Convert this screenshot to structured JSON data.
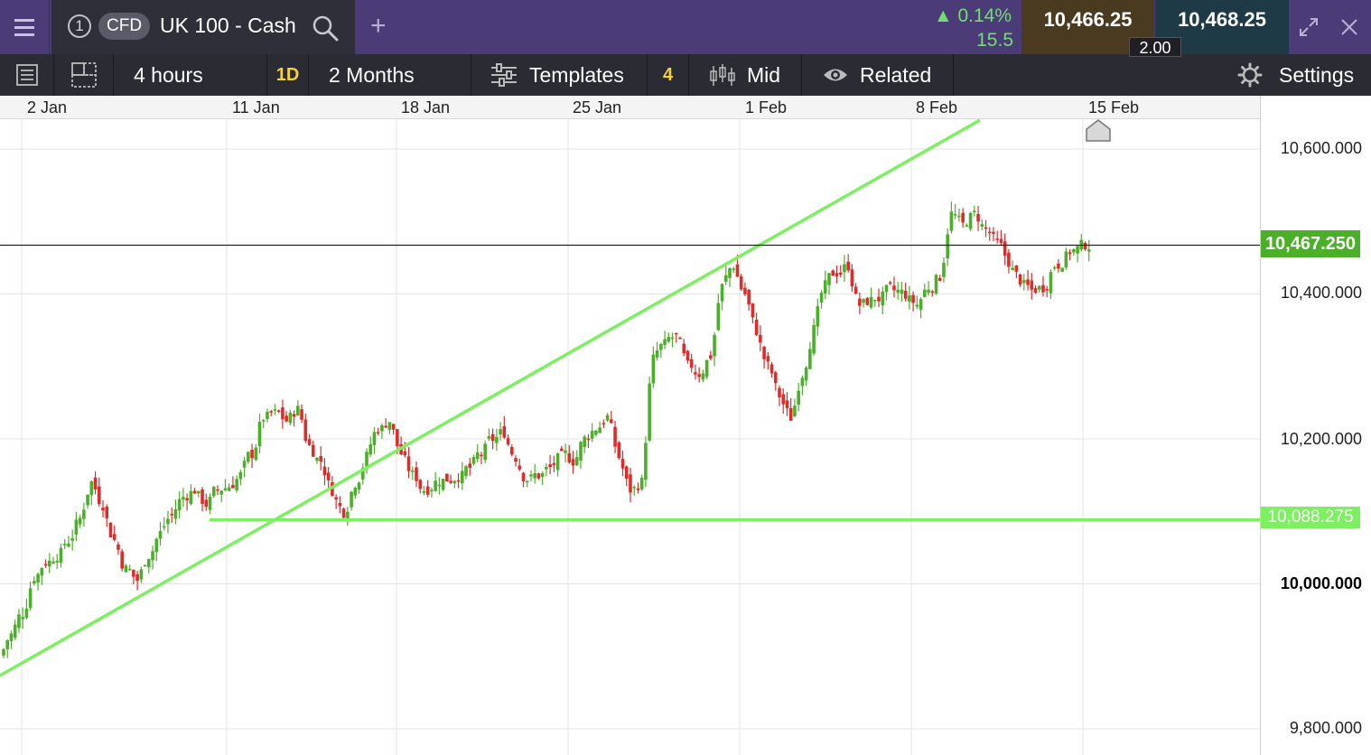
{
  "header": {
    "tab_number": "1",
    "instrument_type": "CFD",
    "instrument_name": "UK 100 - Cash",
    "change_pct": "▲ 0.14%",
    "change_abs": "15.5",
    "sell_price": "10,466.25",
    "buy_price": "10,468.25",
    "spread": "2.00",
    "icons": [
      "menu-icon",
      "search-icon",
      "add-icon",
      "expand-icon",
      "close-icon"
    ]
  },
  "toolbar": {
    "interval": "4 hours",
    "chart_type_badge": "1D",
    "period": "2 Months",
    "templates_label": "Templates",
    "indicator_count": "4",
    "price_mode": "Mid",
    "related_label": "Related",
    "settings_label": "Settings"
  },
  "date_axis": [
    "2 Jan",
    "11 Jan",
    "18 Jan",
    "25 Jan",
    "1 Feb",
    "8 Feb",
    "15 Feb"
  ],
  "price_axis": {
    "ticks": [
      "10,600.000",
      "10,400.000",
      "10,200.000",
      "10,000.000",
      "9,800.000"
    ],
    "current_price_tag": "10,467.250",
    "line_price_tag": "10,088.275"
  },
  "colors": {
    "header_bg": "#4b3b76",
    "up_candle": "#4caf2a",
    "down_candle": "#e02b2b",
    "drawing_line": "#7cf060",
    "current_price_tag": "#4caf2a"
  },
  "chart_data": {
    "type": "candlestick",
    "ylim": [
      9800,
      10600
    ],
    "drawings": [
      {
        "kind": "trendline",
        "from": [
          "2 Jan",
          9935
        ],
        "to": [
          "10 Feb",
          10615
        ]
      },
      {
        "kind": "horizontal",
        "price": 10088.275,
        "from": "10 Jan"
      }
    ],
    "current_price": 10467.25,
    "closes": [
      9930,
      9960,
      10010,
      10030,
      10040,
      10060,
      10090,
      10140,
      10110,
      10060,
      10020,
      10005,
      10040,
      10070,
      10095,
      10120,
      10130,
      10110,
      10130,
      10135,
      10150,
      10180,
      10230,
      10235,
      10225,
      10240,
      10190,
      10170,
      10130,
      10100,
      10140,
      10175,
      10215,
      10225,
      10180,
      10150,
      10130,
      10140,
      10145,
      10150,
      10160,
      10180,
      10200,
      10210,
      10175,
      10145,
      10150,
      10160,
      10175,
      10170,
      10200,
      10215,
      10230,
      10175,
      10130,
      10140,
      10310,
      10330,
      10340,
      10300,
      10290,
      10315,
      10410,
      10440,
      10400,
      10350,
      10300,
      10260,
      10230,
      10290,
      10350,
      10410,
      10430,
      10440,
      10385,
      10390,
      10395,
      10405,
      10400,
      10385,
      10410,
      10425,
      10510,
      10495,
      10510,
      10490,
      10470,
      10445,
      10420,
      10405,
      10410,
      10440,
      10450,
      10462,
      10467
    ]
  }
}
